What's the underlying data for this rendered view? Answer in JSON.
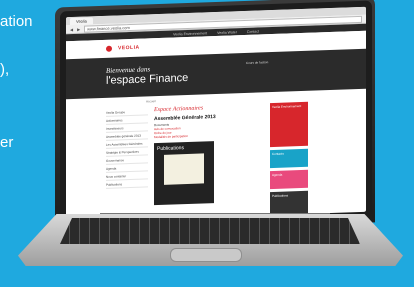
{
  "background": {
    "fragments": [
      "ation",
      "),",
      "er",
      "",
      ""
    ],
    "color": "#1fa9df"
  },
  "browser": {
    "tab_label": "Veolia",
    "url": "www.finance.veolia.com"
  },
  "site": {
    "top_nav": [
      "Veolia Environnement",
      "Veolia Water",
      "Contact"
    ],
    "brand": "VEOLIA",
    "hero_small": "Bienvenue dans",
    "hero_big": "l'espace Finance",
    "hero_side": "Cours de l'action",
    "breadcrumb": "Accueil",
    "left_nav": [
      "Veolia Groupe",
      "Actionnaires",
      "Investisseurs",
      "Assemblée générale 2013",
      "Les Assemblées Générales",
      "Stratégie & Perspectives",
      "Gouvernance",
      "Agenda",
      "Nous contacter",
      "Publications"
    ],
    "main_title": "Espace Actionnaires",
    "main_lead": "Assemblée Générale 2013",
    "main_sub": "Documents",
    "main_links": [
      "Avis de convocation",
      "Ordre du jour",
      "Modalités de participation"
    ],
    "pub_title": "Publications",
    "right_boxes": [
      "Veolia Environnement",
      "Contacts",
      "Agenda",
      "Publications"
    ]
  },
  "colors": {
    "accent": "#d7262c",
    "hero": "#2b2b2b",
    "cyan": "#19a3c8",
    "pink": "#e94a7d"
  }
}
